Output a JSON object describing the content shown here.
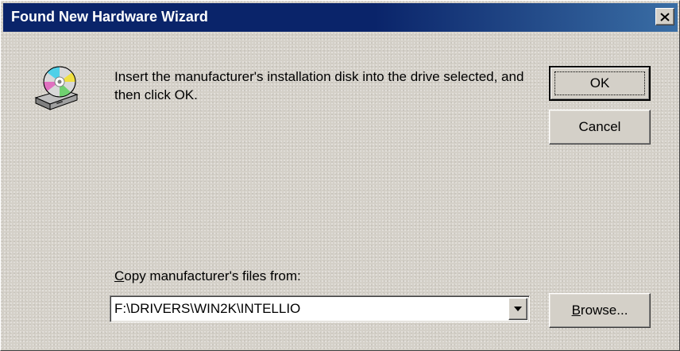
{
  "window": {
    "title": "Found New Hardware Wizard"
  },
  "title_bar": {
    "close_icon": "close-icon",
    "colors": {
      "start": "#0a246a",
      "end": "#3a6ea5"
    }
  },
  "dialog": {
    "icon": "install-disk-icon",
    "message": "Insert the manufacturer's installation disk into the drive selected, and then click OK.",
    "copy_label": {
      "accelerator": "C",
      "rest": "opy manufacturer's files from:"
    },
    "path_combo": {
      "value": "F:\\DRIVERS\\WIN2K\\INTELLIO",
      "arrow_icon": "dropdown-arrow-icon"
    }
  },
  "buttons": {
    "ok": "OK",
    "cancel": "Cancel",
    "browse": {
      "accelerator": "B",
      "rest": "rowse..."
    }
  },
  "colors": {
    "face": "#d4d0c8",
    "highlight": "#ffffff",
    "shadow": "#808080",
    "dark_shadow": "#404040"
  }
}
